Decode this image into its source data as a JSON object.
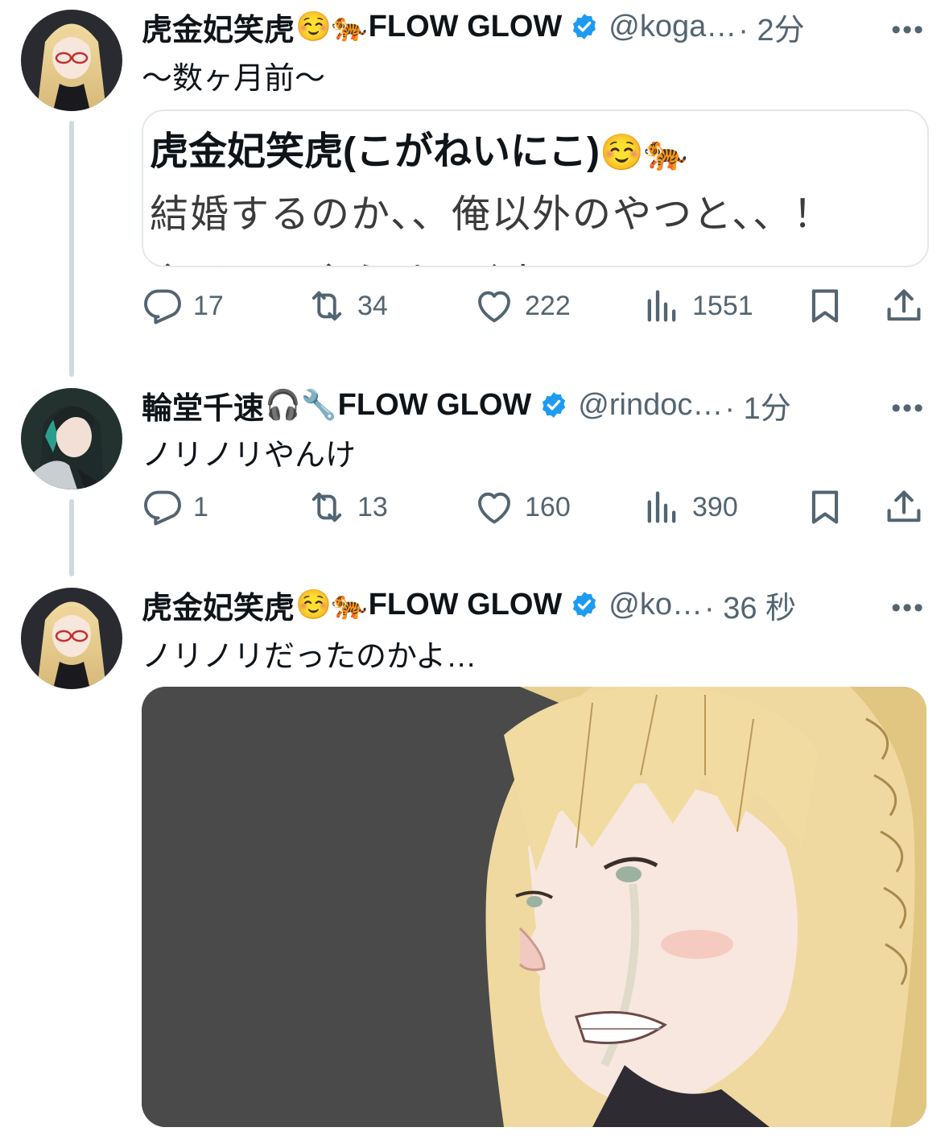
{
  "tweets": [
    {
      "name": "虎金妃笑虎",
      "name_emojis": "☺️🐅",
      "group": "FLOW GLOW",
      "handle": "@koga…",
      "time": "· 2分",
      "more": "•••",
      "text": "〜数ヶ月前〜",
      "quote": {
        "name": "虎金妃笑虎(こがねいにこ)",
        "name_emojis": "☺️🐅",
        "line1": "結婚するのか、、俺以外のやつと、、！",
        "line2": "やる！！やらせてくれ！！！"
      },
      "actions": {
        "reply": "17",
        "retweet": "34",
        "like": "222",
        "views": "1551"
      }
    },
    {
      "name": "輪堂千速",
      "name_emojis": "🎧🔧",
      "group": "FLOW GLOW",
      "handle": "@rindoc…",
      "time": "· 1分",
      "more": "•••",
      "text": "ノリノリやんけ",
      "actions": {
        "reply": "1",
        "retweet": "13",
        "like": "160",
        "views": "390"
      }
    },
    {
      "name": "虎金妃笑虎",
      "name_emojis": "☺️🐅",
      "group": "FLOW GLOW",
      "handle": "@ko…",
      "time": "· 36 秒",
      "more": "•••",
      "text": "ノリノリだったのかよ…"
    }
  ],
  "icons": [
    "reply-icon",
    "retweet-icon",
    "like-icon",
    "views-icon",
    "bookmark-icon",
    "share-icon",
    "verified-badge-icon",
    "more-icon"
  ],
  "colors": {
    "verified": "#1d9bf0",
    "secondary_text": "#536471",
    "thread_line": "#cfd9de",
    "media_bg": "#4a4a4a"
  }
}
